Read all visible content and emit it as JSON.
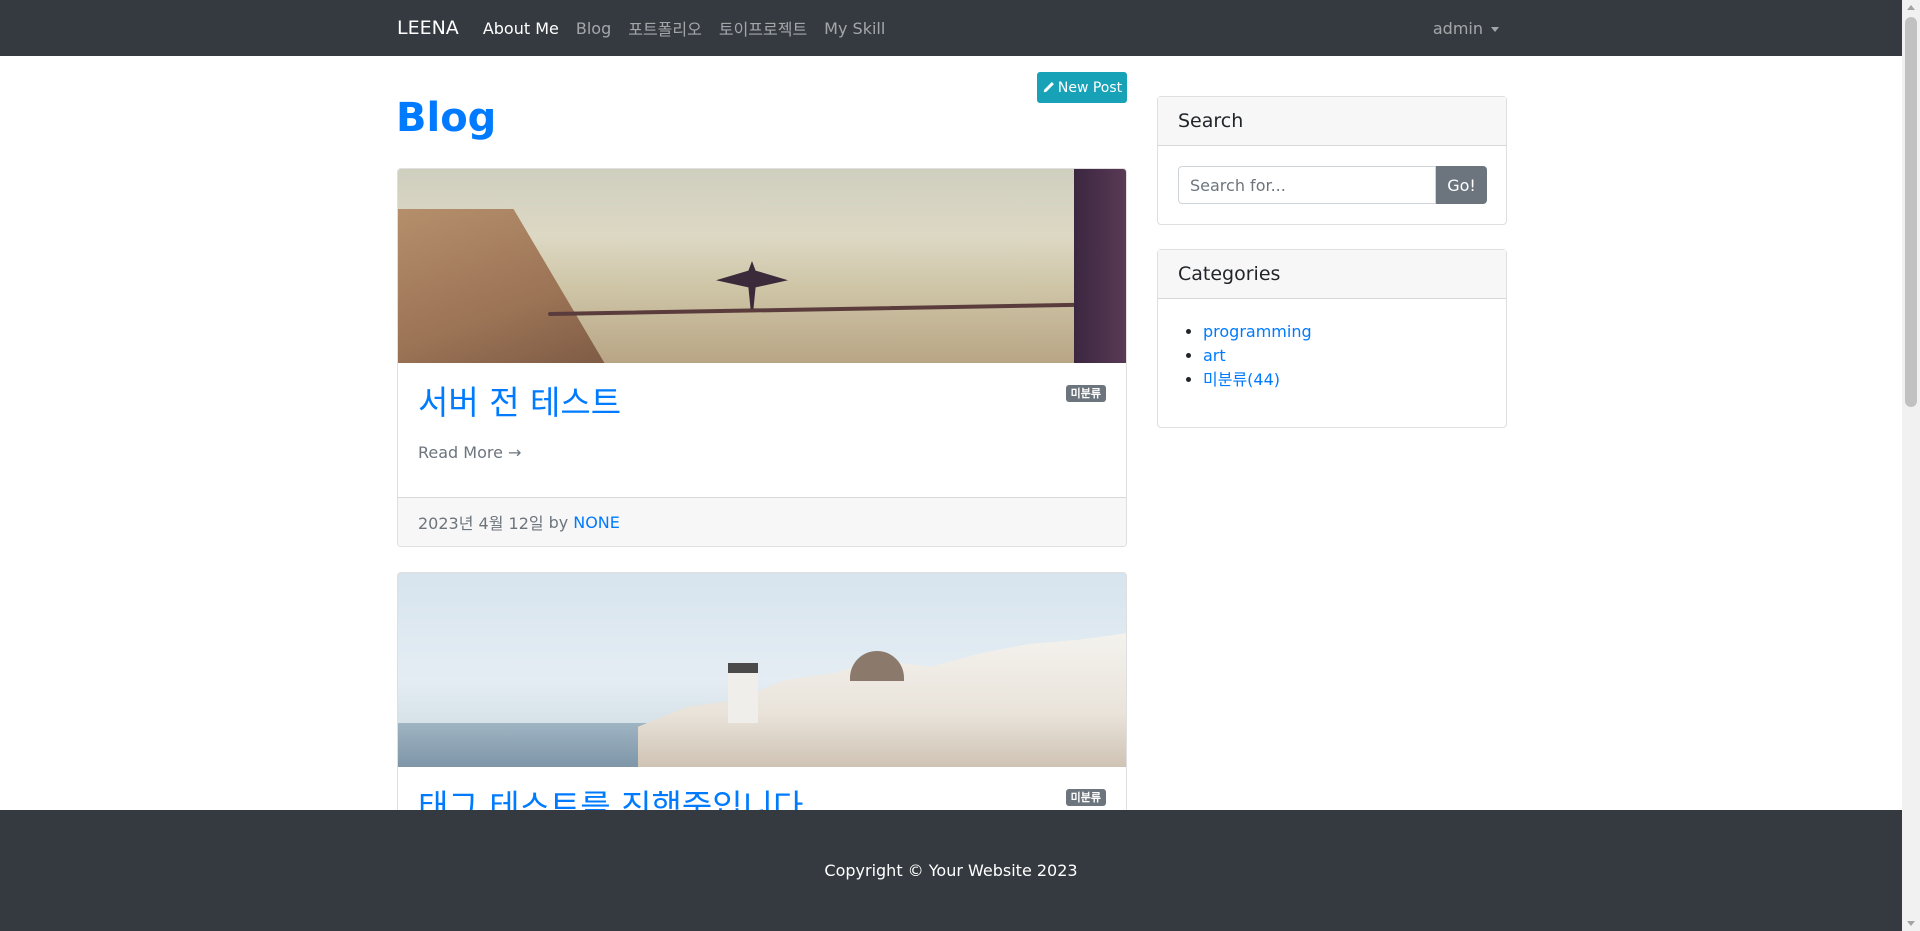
{
  "navbar": {
    "brand": "LEENA",
    "links": [
      {
        "label": "About Me",
        "active": true
      },
      {
        "label": "Blog",
        "active": false
      },
      {
        "label": "포트폴리오",
        "active": false
      },
      {
        "label": "토이프로젝트",
        "active": false
      },
      {
        "label": "My Skill",
        "active": false
      }
    ],
    "user_menu": "admin"
  },
  "main": {
    "new_post_label": "New Post",
    "new_post_icon": "pencil-icon",
    "page_title": "Blog",
    "posts": [
      {
        "title": "서버 전 테스트",
        "category_badge": "미분류",
        "read_more": "Read More →",
        "date": "2023년 4월 12일",
        "by": "by",
        "author": "NONE"
      },
      {
        "title": "태그 테스트를 진행중입니다",
        "category_badge": "미분류"
      }
    ]
  },
  "sidebar": {
    "search": {
      "title": "Search",
      "placeholder": "Search for...",
      "button_label": "Go!"
    },
    "categories": {
      "title": "Categories",
      "items": [
        "programming",
        "art",
        "미분류(44)"
      ]
    }
  },
  "footer": {
    "copyright": "Copyright © Your Website 2023"
  },
  "colors": {
    "navbar_bg": "#343a40",
    "primary": "#007bff",
    "info": "#17a2b8",
    "secondary": "#6c757d"
  }
}
